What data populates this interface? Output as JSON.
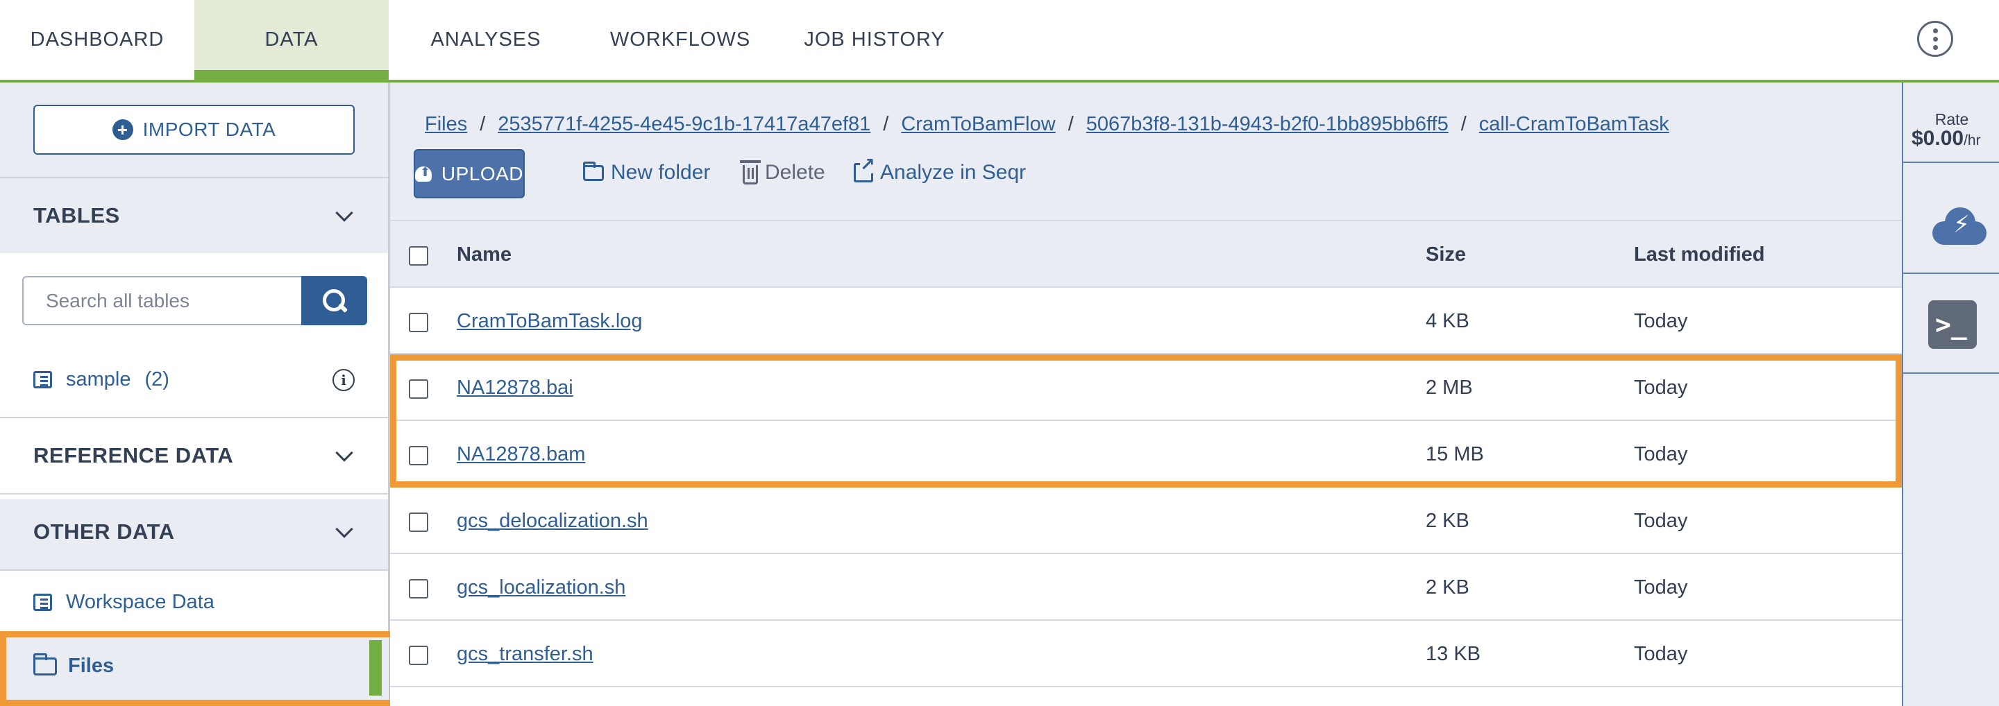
{
  "nav": {
    "tabs": [
      {
        "label": "DASHBOARD"
      },
      {
        "label": "DATA"
      },
      {
        "label": "ANALYSES"
      },
      {
        "label": "WORKFLOWS"
      },
      {
        "label": "JOB HISTORY"
      }
    ],
    "active_tab": "DATA",
    "menu_icon": "kebab-vertical-icon"
  },
  "sidebar": {
    "import_label": "IMPORT DATA",
    "sections": {
      "tables": "TABLES",
      "reference": "REFERENCE DATA",
      "other": "OTHER DATA"
    },
    "search_placeholder": "Search all tables",
    "tables": [
      {
        "name": "sample",
        "count": "(2)"
      }
    ],
    "other_items": [
      {
        "label": "Workspace Data"
      },
      {
        "label": "Files"
      }
    ],
    "selected_item": "Files"
  },
  "breadcrumb": [
    {
      "label": "Files"
    },
    {
      "label": "2535771f-4255-4e45-9c1b-17417a47ef81"
    },
    {
      "label": "CramToBamFlow"
    },
    {
      "label": "5067b3f8-131b-4943-b2f0-1bb895bb6ff5"
    },
    {
      "label": "call-CramToBamTask"
    }
  ],
  "breadcrumb_separator": "/",
  "toolbar": {
    "upload_label": "UPLOAD",
    "new_folder_label": "New folder",
    "delete_label": "Delete",
    "analyze_label": "Analyze in Seqr"
  },
  "table": {
    "headers": {
      "name": "Name",
      "size": "Size",
      "modified": "Last modified"
    },
    "rows": [
      {
        "name": "CramToBamTask.log",
        "size": "4 KB",
        "modified": "Today"
      },
      {
        "name": "NA12878.bai",
        "size": "2 MB",
        "modified": "Today"
      },
      {
        "name": "NA12878.bam",
        "size": "15 MB",
        "modified": "Today"
      },
      {
        "name": "gcs_delocalization.sh",
        "size": "2 KB",
        "modified": "Today"
      },
      {
        "name": "gcs_localization.sh",
        "size": "2 KB",
        "modified": "Today"
      },
      {
        "name": "gcs_transfer.sh",
        "size": "13 KB",
        "modified": "Today"
      }
    ]
  },
  "rail": {
    "rate_label": "Rate",
    "rate_value": "$0.00",
    "rate_unit": "/hr",
    "icons": [
      "cloud-environment-icon",
      "terminal-icon"
    ]
  },
  "colors": {
    "accent_green": "#74ae43",
    "link_blue": "#2f5e95",
    "highlight_orange": "#ef9a36",
    "panel_gray": "#e9ecf2"
  }
}
